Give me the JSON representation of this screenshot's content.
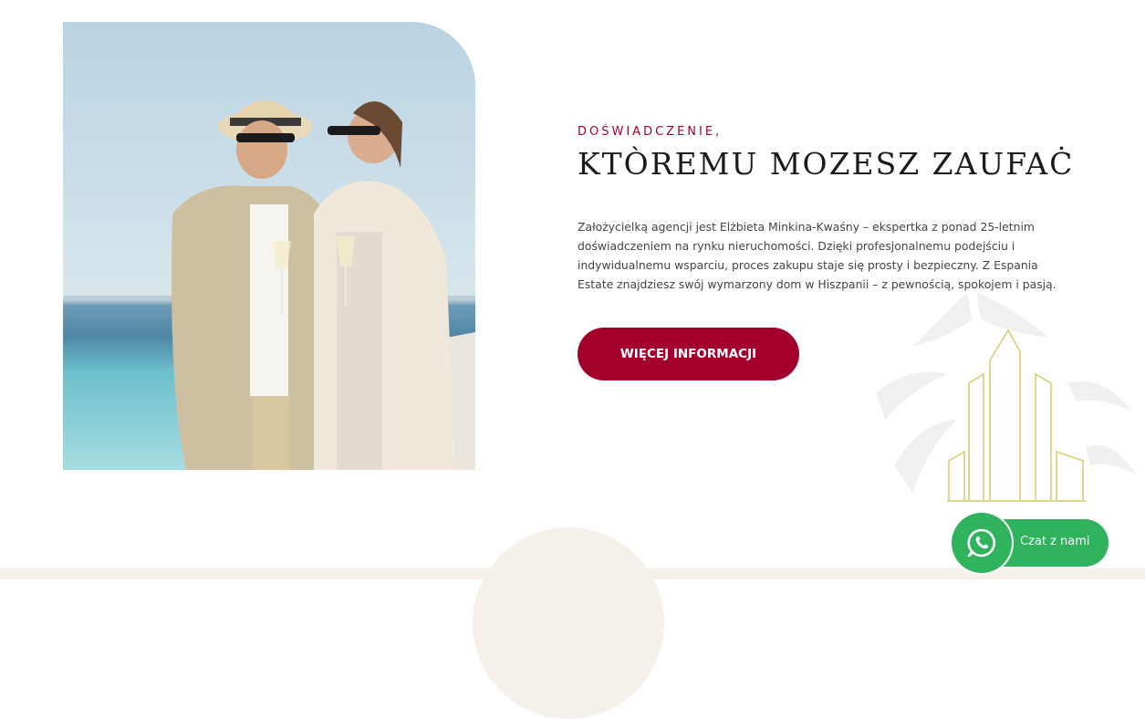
{
  "section": {
    "eyebrow": "DOŚWIADCZENIE,",
    "headline": "KTÒREMU MOZESZ ZAUFAĊ",
    "body": "Założycielką agencji jest Elżbieta Minkina-Kwaśny – ekspertka z ponad 25-letnim doświadczeniem na rynku nieruchomości. Dzięki profesjonalnemu podejściu i indywidualnemu wsparciu, proces zakupu staje się prosty i bezpieczny. Z Espania Estate znajdziesz swój wymarzony dom w Hiszpanii – z pewnością, spokojem i pasją.",
    "cta_label": "WIĘCEJ INFORMACJI"
  },
  "chat": {
    "label": "Czat z nami",
    "icon": "whatsapp-icon"
  },
  "colors": {
    "accent": "#a4002c",
    "chat_green": "#2fb45d",
    "gold": "#d6cc6a",
    "band": "#f5f0e9"
  }
}
